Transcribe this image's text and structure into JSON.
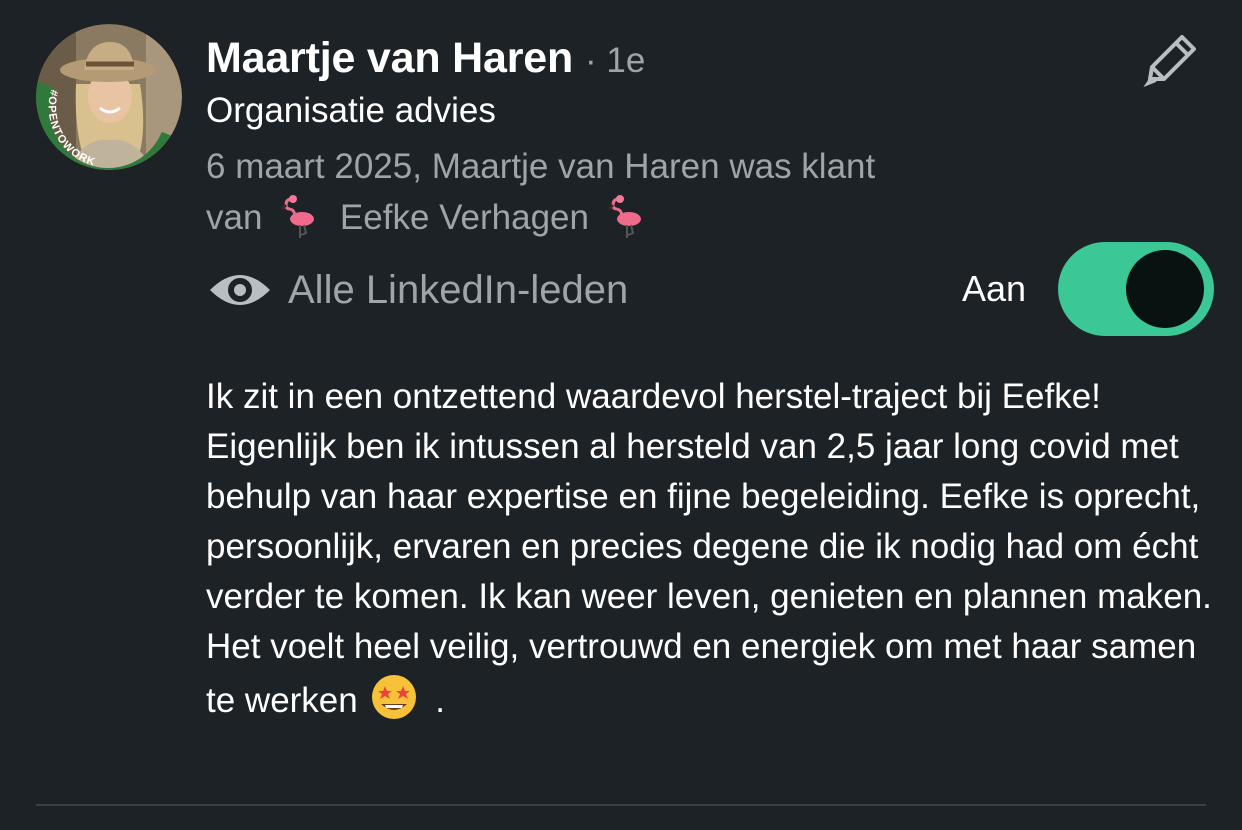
{
  "review": {
    "author_name": "Maartje van Haren",
    "degree": "· 1e",
    "headline": "Organisatie advies",
    "meta_prefix": "6 maart 2025, Maartje van Haren was klant",
    "meta_van": "van",
    "company": "Eefke Verhagen",
    "badge": "#OPENTOWORK",
    "visibility_label": "Alle LinkedIn-leden",
    "toggle_label": "Aan",
    "toggle_on": true,
    "body": "Ik zit in een ontzettend waardevol herstel-traject bij Eefke! Eigenlijk ben ik intussen al hersteld van 2,5 jaar long covid met behulp van haar expertise en fijne begeleiding. Eefke is oprecht, persoonlijk, ervaren en precies degene die ik nodig had om écht verder te komen. Ik kan weer leven, genieten en plannen maken. Het voelt heel veilig, vertrouwd en energiek om met haar samen te werken",
    "body_end": "."
  },
  "icons": {
    "edit": "pencil-icon",
    "visibility": "eye-icon",
    "flamingo": "flamingo-emoji",
    "emoji_end": "star-struck-emoji"
  },
  "colors": {
    "background": "#1d2226",
    "muted_text": "#9ea4a9",
    "toggle_on": "#3cc796",
    "badge_green": "#2f7a3a"
  }
}
